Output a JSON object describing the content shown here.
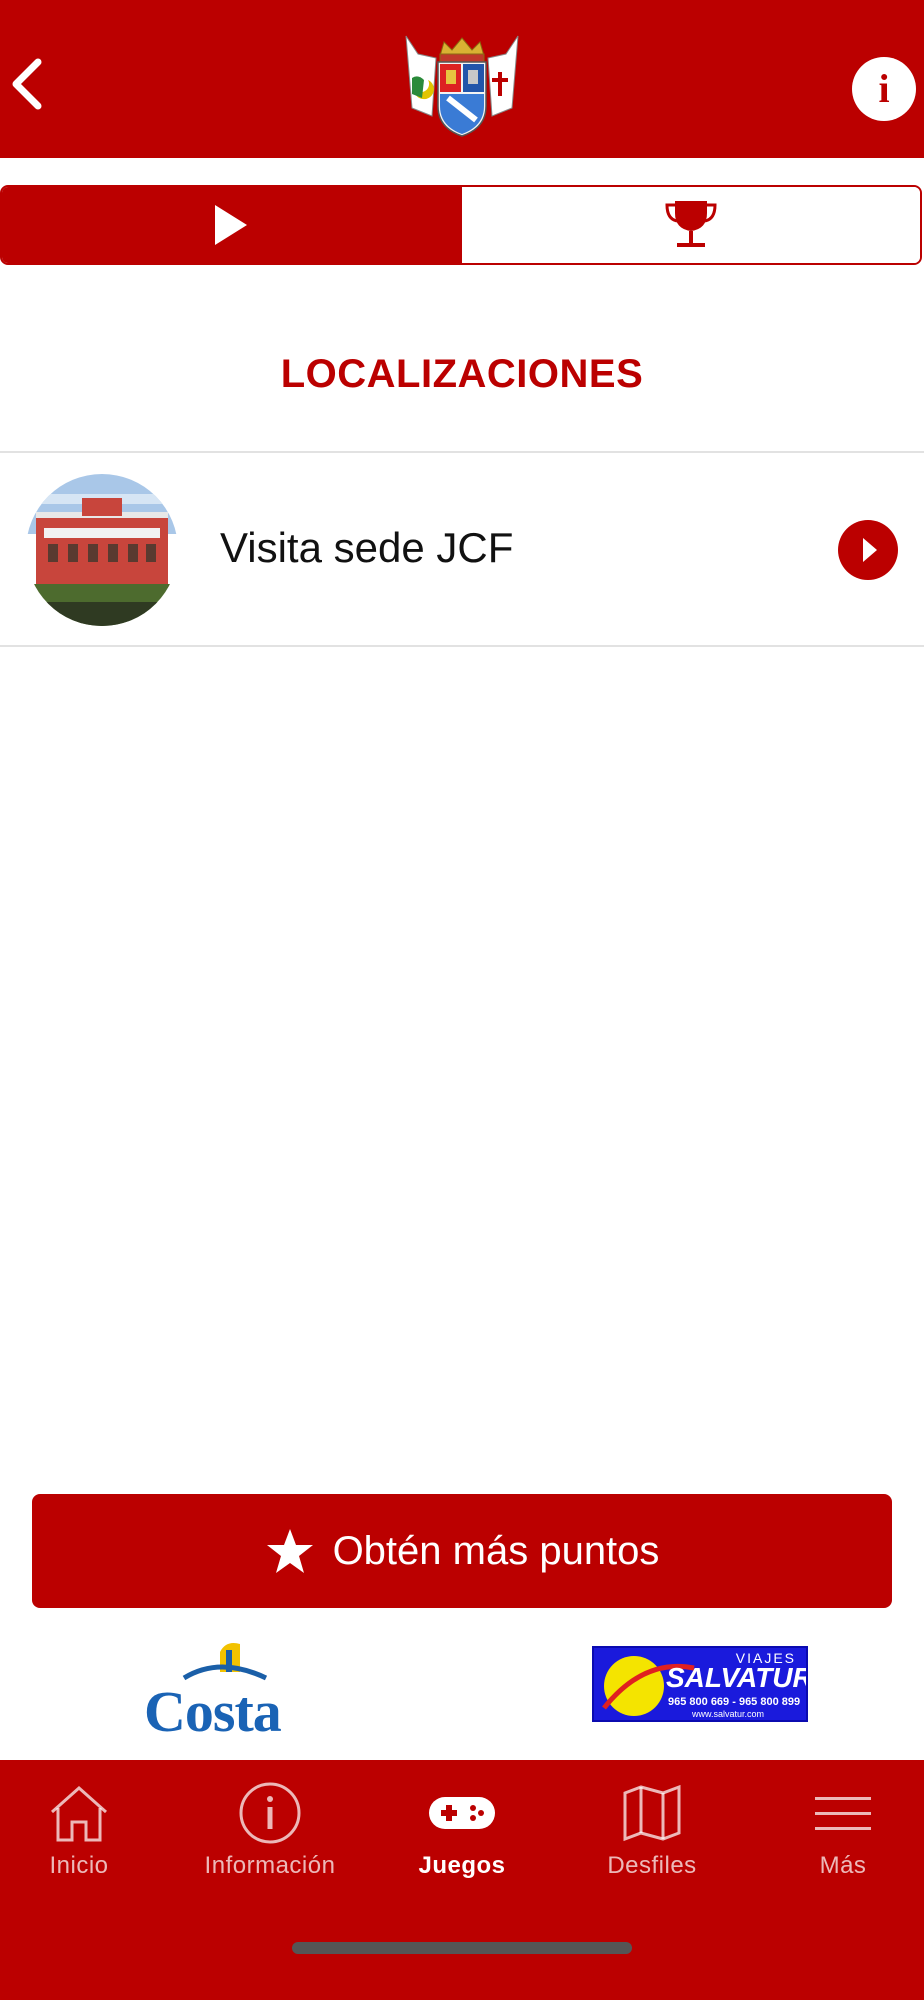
{
  "colors": {
    "brand": "#bb0000",
    "background": "#ffffff",
    "text": "#111111"
  },
  "header": {
    "back_icon": "chevron-left-icon",
    "logo": "coat-of-arms-logo",
    "info_label": "i"
  },
  "segments": [
    {
      "icon": "play-icon",
      "active": true
    },
    {
      "icon": "trophy-icon",
      "active": false
    }
  ],
  "section": {
    "title": "LOCALIZACIONES"
  },
  "locations": [
    {
      "label": "Visita sede JCF",
      "thumbnail": "building-photo",
      "action_icon": "chevron-right-circle-icon"
    }
  ],
  "cta": {
    "icon": "star-icon",
    "label": "Obtén más puntos"
  },
  "sponsors": {
    "costa": {
      "name": "Costa"
    },
    "salvatur": {
      "top": "VIAJES",
      "name": "SALVATUR",
      "phones": "965 800 669 - 965 800 899",
      "web": "www.salvatur.com"
    }
  },
  "tabbar": {
    "active": "Juegos",
    "tabs": [
      {
        "label": "Inicio",
        "icon": "home-icon"
      },
      {
        "label": "Información",
        "icon": "info-circle-icon"
      },
      {
        "label": "Juegos",
        "icon": "gamepad-icon"
      },
      {
        "label": "Desfiles",
        "icon": "map-icon"
      },
      {
        "label": "Más",
        "icon": "menu-icon"
      }
    ]
  }
}
